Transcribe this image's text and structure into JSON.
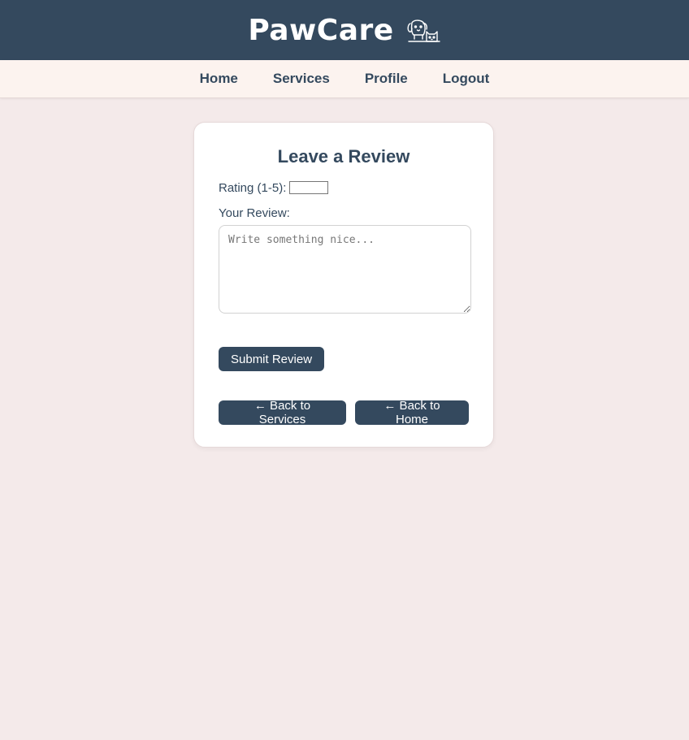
{
  "header": {
    "brand": "PawCare",
    "brand_icon": "dog-and-cat-icon"
  },
  "nav": {
    "items": [
      {
        "label": "Home"
      },
      {
        "label": "Services"
      },
      {
        "label": "Profile"
      },
      {
        "label": "Logout"
      }
    ]
  },
  "form": {
    "title": "Leave a Review",
    "rating_label": "Rating (1-5):",
    "rating_value": "",
    "review_label": "Your Review:",
    "review_placeholder": "Write something nice...",
    "submit_label": "Submit Review",
    "back_services_label": "← Back to Services",
    "back_home_label": "← Back to Home"
  },
  "colors": {
    "primary": "#34495e",
    "nav_bg": "#fcf3ef",
    "page_bg": "#f4eaea"
  }
}
